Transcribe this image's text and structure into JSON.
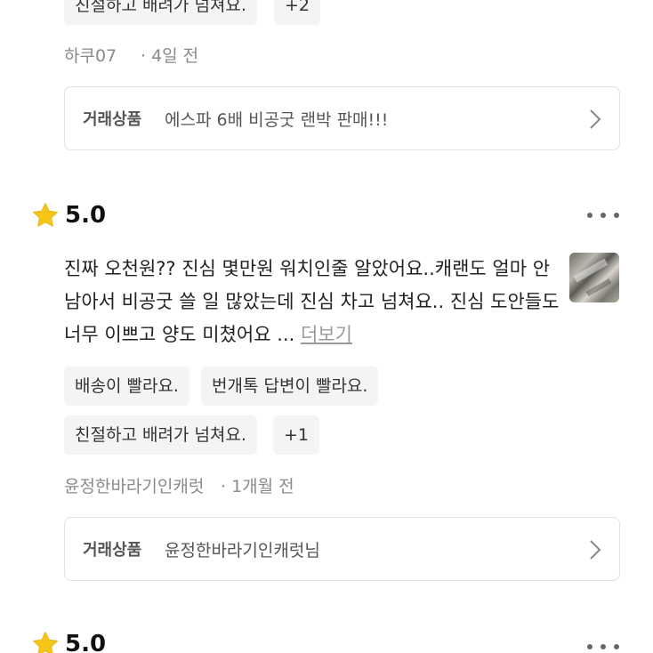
{
  "review_top": {
    "tags": [
      "친절하고 배려가 넘쳐요.",
      "+2"
    ],
    "author": "하쿠07",
    "time": "· 4일 전",
    "trade": {
      "label": "거래상품",
      "name": "에스파 6배 비공굿 랜박 판매!!!"
    }
  },
  "review_main": {
    "rating": "5.0",
    "text": "진짜 오천원?? 진심 몇만원 워치인줄 알았어요..캐랜도 얼마 안 남아서 비공굿 쓸 일 많았는데 진심 차고 넘쳐요.. 진심 도안들도 너무 이쁘고 양도 미쳤어요 ...",
    "see_more": "더보기",
    "tags_row1": [
      "배송이 빨라요.",
      "번개톡 답변이 빨라요."
    ],
    "tags_row2": [
      "친절하고 배려가 넘쳐요.",
      "+1"
    ],
    "author": "윤정한바라기인캐럿",
    "time": "· 1개월 전",
    "trade": {
      "label": "거래상품",
      "name": "윤정한바라기인캐럿님"
    }
  },
  "review_bottom": {
    "rating": "5.0"
  },
  "icons": {
    "star_color": "#f5c518",
    "star": "star-icon",
    "more": "more-horizontal-icon",
    "chevron": "chevron-right-icon"
  }
}
